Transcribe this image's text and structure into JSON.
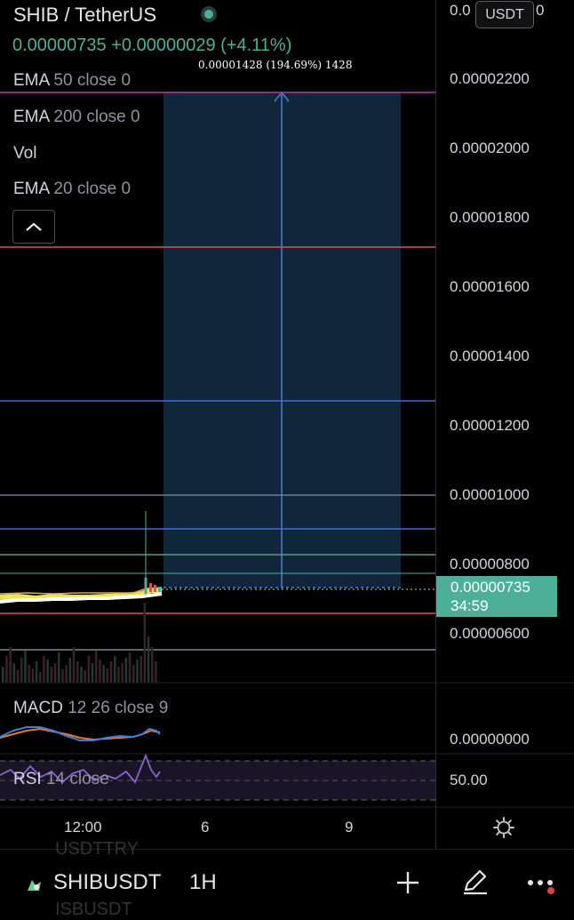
{
  "header": {
    "pair": "SHIB / TetherUS",
    "price": "0.00000735",
    "change": "+0.00000029",
    "change_pct": "(+4.11%)"
  },
  "indicators": [
    {
      "name": "EMA",
      "params": "50 close 0"
    },
    {
      "name": "EMA",
      "params": "200 close 0"
    },
    {
      "name": "Vol",
      "params": ""
    },
    {
      "name": "EMA",
      "params": "20 close 0"
    }
  ],
  "measure_label": "0.00001428 (194.69%) 1428",
  "y_axis": {
    "currency": "USDT",
    "top_partial": "0.0",
    "top_partial_tail": "0",
    "ticks": [
      "0.00002200",
      "0.00002000",
      "0.00001800",
      "0.00001600",
      "0.00001400",
      "0.00001200",
      "0.00001000",
      "0.00000800",
      "0.00000600"
    ],
    "current_price": "0.00000735",
    "countdown": "34:59"
  },
  "macd": {
    "name": "MACD",
    "params": "12 26 close 9",
    "axis_value": "0.00000000"
  },
  "rsi": {
    "name": "RSI",
    "params": "14 close",
    "axis_value": "50.00"
  },
  "x_axis": [
    "12:00",
    "6",
    "9"
  ],
  "bottom_bar": {
    "symbol": "SHIBUSDT",
    "timeframe": "1H",
    "ghost_above": "USDTTRY",
    "ghost_below": "ISBUSDT"
  },
  "colors": {
    "up": "#4caf9a",
    "red_line": "#e04f5f",
    "blue_line": "#3d6fc9",
    "measure_fill": "#10263b",
    "ema_yellow": "#f1e15b"
  },
  "icons": [
    "live-dot-icon",
    "chevron-up-icon",
    "settings-gear-icon",
    "plus-icon",
    "pen-icon",
    "more-dots-icon",
    "shib-logo-icon"
  ]
}
